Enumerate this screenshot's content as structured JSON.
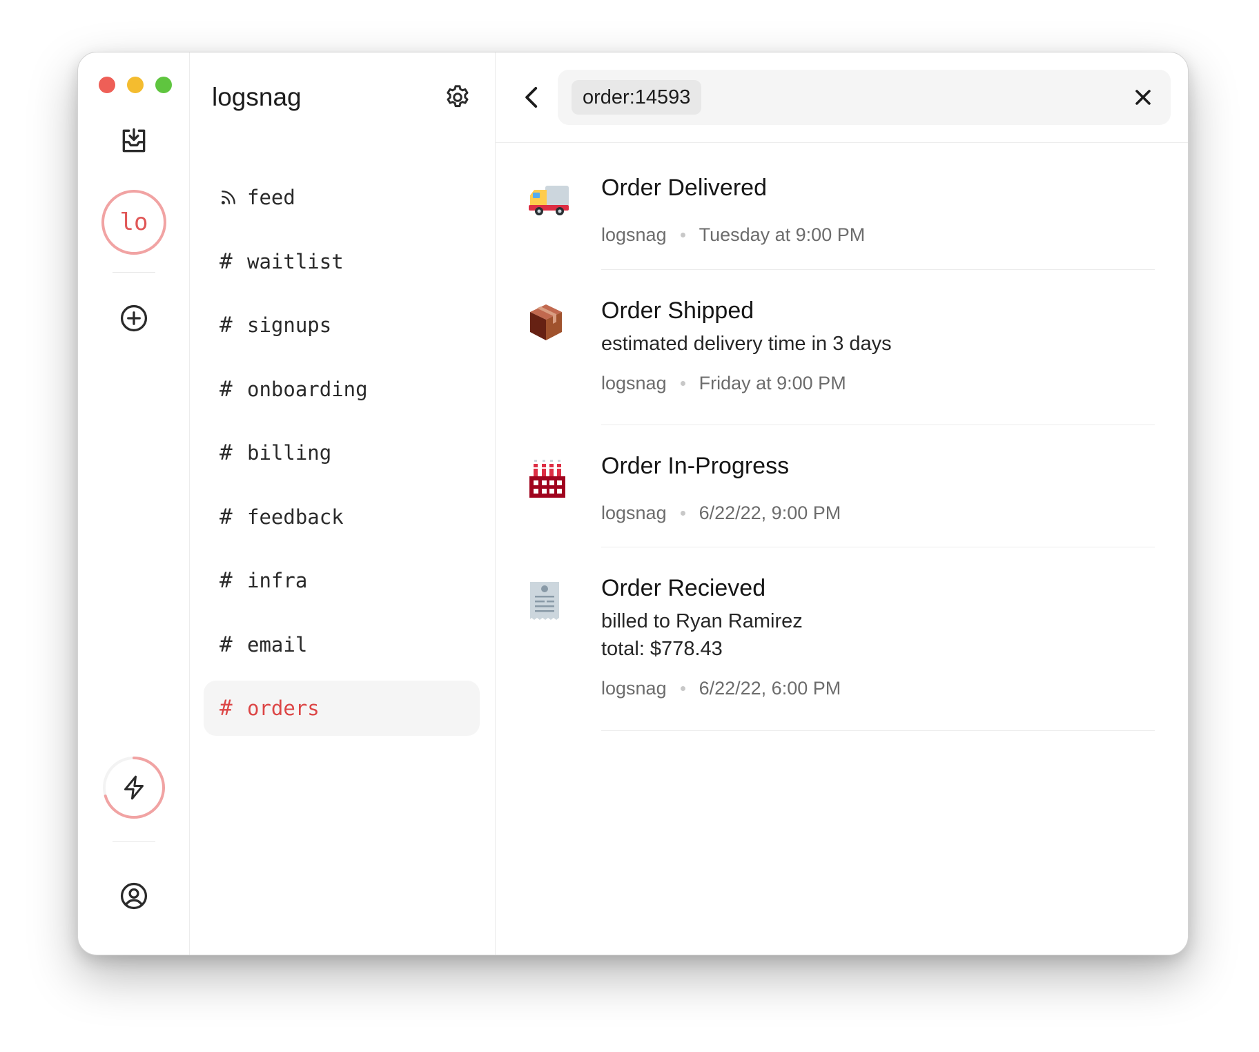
{
  "rail": {
    "project_initials": "lo"
  },
  "sidebar": {
    "project_name": "logsnag",
    "channels": [
      {
        "prefix": "",
        "label": "feed",
        "icon": "rss-icon"
      },
      {
        "prefix": "#",
        "label": "waitlist"
      },
      {
        "prefix": "#",
        "label": "signups"
      },
      {
        "prefix": "#",
        "label": "onboarding"
      },
      {
        "prefix": "#",
        "label": "billing"
      },
      {
        "prefix": "#",
        "label": "feedback"
      },
      {
        "prefix": "#",
        "label": "infra"
      },
      {
        "prefix": "#",
        "label": "email"
      },
      {
        "prefix": "#",
        "label": "orders",
        "active": true
      }
    ]
  },
  "search": {
    "query": "order:14593"
  },
  "events": [
    {
      "icon": "delivery-truck-icon",
      "title": "Order Delivered",
      "description": [],
      "source": "logsnag",
      "time": "Tuesday at 9:00 PM"
    },
    {
      "icon": "package-icon",
      "title": "Order Shipped",
      "description": [
        "estimated delivery time in 3 days"
      ],
      "source": "logsnag",
      "time": "Friday at 9:00 PM"
    },
    {
      "icon": "factory-icon",
      "title": "Order In-Progress",
      "description": [],
      "source": "logsnag",
      "time": "6/22/22, 9:00 PM"
    },
    {
      "icon": "receipt-icon",
      "title": "Order Recieved",
      "description": [
        "billed to Ryan Ramirez",
        "total: $778.43"
      ],
      "source": "logsnag",
      "time": "6/22/22, 6:00 PM"
    }
  ],
  "colors": {
    "accent": "#dc4545",
    "accent_light": "#f1a3a3",
    "traffic_red": "#ee5f57",
    "traffic_yellow": "#f4bc2f",
    "traffic_green": "#5fc53f"
  }
}
